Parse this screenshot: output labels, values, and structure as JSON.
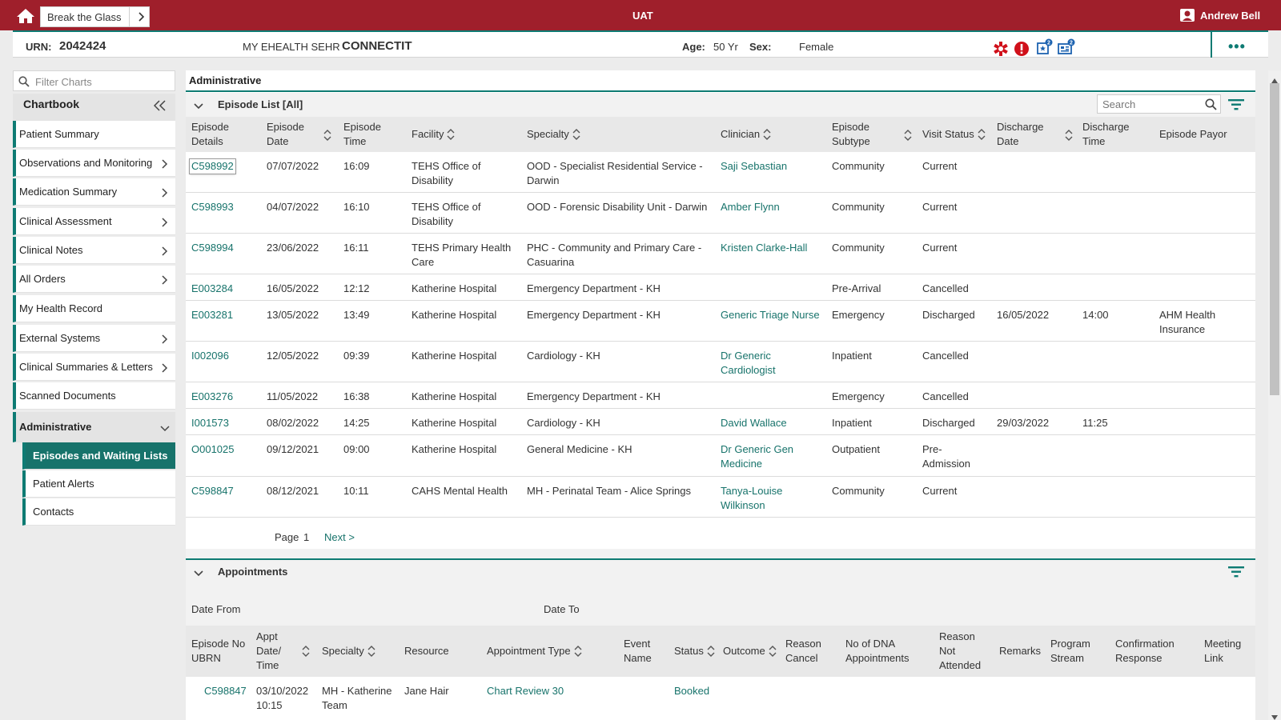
{
  "topbar": {
    "btg_label": "Break the Glass",
    "environment": "UAT",
    "user_name": "Andrew Bell",
    "color": "#9f1f2b"
  },
  "banner": {
    "urn_label": "URN:",
    "urn_value": "2042424",
    "program_small": "MY EHEALTH SEHR",
    "program_large": "CONNECTIT",
    "age_label": "Age:",
    "age_value": "50 Yr",
    "sex_label": "Sex:",
    "sex_value": "Female",
    "badge_count_1": "2",
    "badge_count_2": "2",
    "accent": "#0e7b73"
  },
  "sidebar": {
    "filter_placeholder": "Filter Charts",
    "chartbook_title": "Chartbook",
    "items": [
      {
        "label": "Patient Summary"
      },
      {
        "label": "Observations and Monitoring"
      },
      {
        "label": "Medication Summary"
      },
      {
        "label": "Clinical Assessment"
      },
      {
        "label": "Clinical Notes"
      },
      {
        "label": "All Orders"
      },
      {
        "label": "My Health Record"
      },
      {
        "label": "External Systems"
      },
      {
        "label": "Clinical Summaries & Letters"
      },
      {
        "label": "Scanned Documents"
      },
      {
        "label": "Administrative"
      }
    ],
    "sub_items": [
      {
        "label": "Episodes and Waiting Lists"
      },
      {
        "label": "Patient Alerts"
      },
      {
        "label": "Contacts"
      }
    ]
  },
  "main": {
    "title": "Administrative",
    "episodes": {
      "title": "Episode List [All]",
      "search_placeholder": "Search",
      "columns": {
        "details": "Episode Details",
        "date": "Episode Date",
        "time": "Episode Time",
        "facility": "Facility",
        "specialty": "Specialty",
        "clinician": "Clinician",
        "subtype": "Episode Subtype",
        "visit_status": "Visit Status",
        "discharge_date": "Discharge Date",
        "discharge_time": "Discharge Time",
        "payor": "Episode Payor"
      },
      "rows": [
        {
          "id": "C598992",
          "date": "07/07/2022",
          "time": "16:09",
          "facility": "TEHS Office of Disability",
          "specialty": "OOD - Specialist Residential Service - Darwin",
          "clinician": "Saji Sebastian",
          "subtype": "Community",
          "status": "Current",
          "dis_date": "",
          "dis_time": "",
          "payor": ""
        },
        {
          "id": "C598993",
          "date": "04/07/2022",
          "time": "16:10",
          "facility": "TEHS Office of Disability",
          "specialty": "OOD - Forensic Disability Unit - Darwin",
          "clinician": "Amber Flynn",
          "subtype": "Community",
          "status": "Current",
          "dis_date": "",
          "dis_time": "",
          "payor": ""
        },
        {
          "id": "C598994",
          "date": "23/06/2022",
          "time": "16:11",
          "facility": "TEHS Primary Health Care",
          "specialty": "PHC - Community and Primary Care - Casuarina",
          "clinician": "Kristen Clarke-Hall",
          "subtype": "Community",
          "status": "Current",
          "dis_date": "",
          "dis_time": "",
          "payor": ""
        },
        {
          "id": "E003284",
          "date": "16/05/2022",
          "time": "12:12",
          "facility": "Katherine Hospital",
          "specialty": "Emergency Department - KH",
          "clinician": "",
          "subtype": "Pre-Arrival",
          "status": "Cancelled",
          "dis_date": "",
          "dis_time": "",
          "payor": ""
        },
        {
          "id": "E003281",
          "date": "13/05/2022",
          "time": "13:49",
          "facility": "Katherine Hospital",
          "specialty": "Emergency Department - KH",
          "clinician": "Generic Triage Nurse",
          "subtype": "Emergency",
          "status": "Discharged",
          "dis_date": "16/05/2022",
          "dis_time": "14:00",
          "payor": "AHM Health Insurance"
        },
        {
          "id": "I002096",
          "date": "12/05/2022",
          "time": "09:39",
          "facility": "Katherine Hospital",
          "specialty": "Cardiology - KH",
          "clinician": "Dr Generic Cardiologist",
          "subtype": "Inpatient",
          "status": "Cancelled",
          "dis_date": "",
          "dis_time": "",
          "payor": ""
        },
        {
          "id": "E003276",
          "date": "11/05/2022",
          "time": "16:38",
          "facility": "Katherine Hospital",
          "specialty": "Emergency Department - KH",
          "clinician": "",
          "subtype": "Emergency",
          "status": "Cancelled",
          "dis_date": "",
          "dis_time": "",
          "payor": ""
        },
        {
          "id": "I001573",
          "date": "08/02/2022",
          "time": "14:25",
          "facility": "Katherine Hospital",
          "specialty": "Cardiology - KH",
          "clinician": "David Wallace",
          "subtype": "Inpatient",
          "status": "Discharged",
          "dis_date": "29/03/2022",
          "dis_time": "11:25",
          "payor": ""
        },
        {
          "id": "O001025",
          "date": "09/12/2021",
          "time": "09:00",
          "facility": "Katherine Hospital",
          "specialty": "General Medicine - KH",
          "clinician": "Dr Generic Gen Medicine",
          "subtype": "Outpatient",
          "status": "Pre-Admission",
          "dis_date": "",
          "dis_time": "",
          "payor": ""
        },
        {
          "id": "C598847",
          "date": "08/12/2021",
          "time": "10:11",
          "facility": "CAHS Mental Health",
          "specialty": "MH - Perinatal Team - Alice Springs",
          "clinician": "Tanya-Louise Wilkinson",
          "subtype": "Community",
          "status": "Current",
          "dis_date": "",
          "dis_time": "",
          "payor": ""
        }
      ],
      "page_label": "Page",
      "page_number": "1",
      "next_label": "Next >"
    },
    "appointments": {
      "title": "Appointments",
      "date_from_label": "Date From",
      "date_to_label": "Date To",
      "columns": {
        "episode_no": "Episode No UBRN",
        "appt_date": "Appt Date/ Time",
        "specialty": "Specialty",
        "resource": "Resource",
        "appt_type": "Appointment Type",
        "event_name": "Event Name",
        "status": "Status",
        "outcome": "Outcome",
        "reason_cancel": "Reason Cancel",
        "dna": "No of DNA Appointments",
        "reason_not_attended": "Reason Not Attended",
        "remarks": "Remarks",
        "program_stream": "Program Stream",
        "confirmation": "Confirmation Response",
        "meeting_link": "Meeting Link"
      },
      "rows": [
        {
          "episode_no": "C598847",
          "appt_date": "03/10/2022 10:15",
          "specialty": "MH - Katherine Team",
          "resource": "Jane Hair",
          "appt_type": "Chart Review 30",
          "status": "Booked"
        }
      ]
    }
  }
}
